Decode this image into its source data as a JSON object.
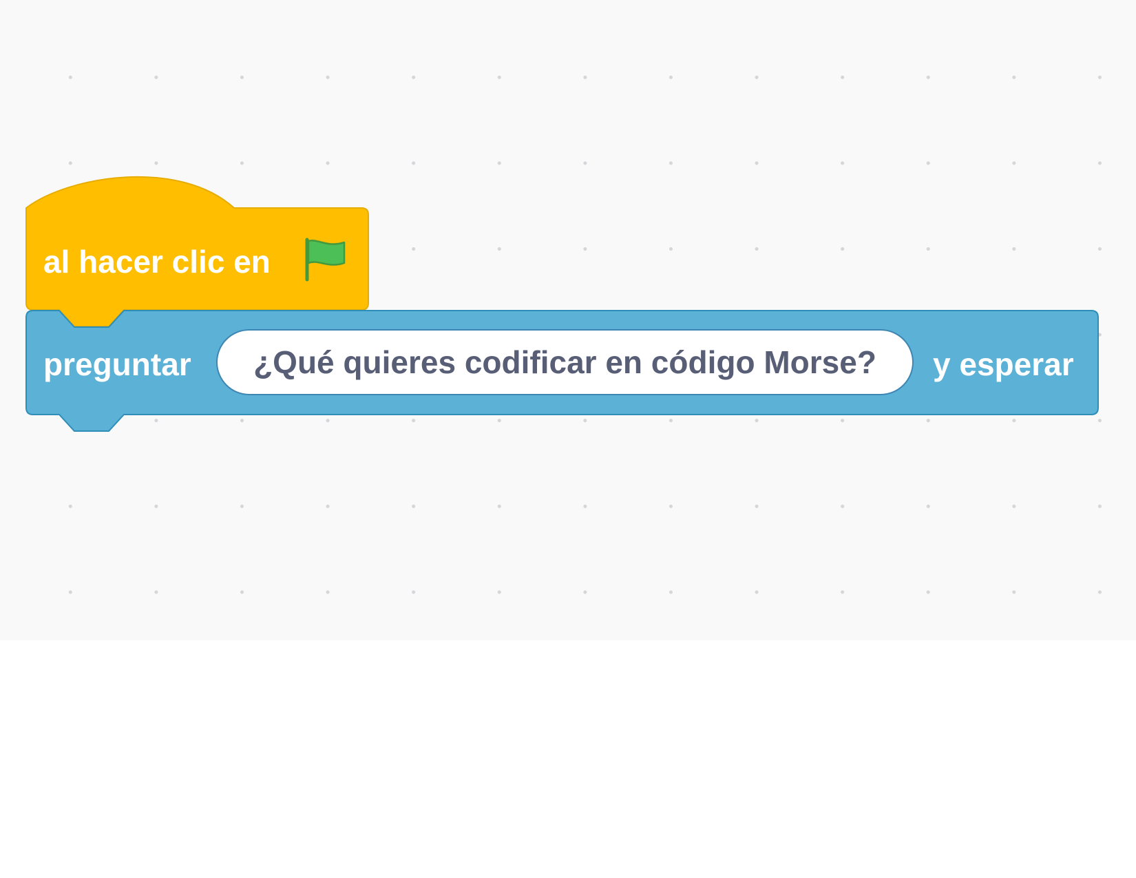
{
  "workspace": {
    "background": "#f9f9f9",
    "grid_dot_color": "#d4d6d9"
  },
  "event_block": {
    "label": "al hacer clic en",
    "icon": "green-flag-icon",
    "color": "#ffbf00",
    "border_color": "#e6ac00"
  },
  "ask_block": {
    "label": "preguntar",
    "question_value": "¿Qué quieres codificar en código Morse?",
    "suffix": "y esperar",
    "color": "#5cb1d6",
    "border_color": "#2e8eb8"
  },
  "flag_colors": {
    "fill": "#4cbf56",
    "stroke": "#45993d"
  }
}
